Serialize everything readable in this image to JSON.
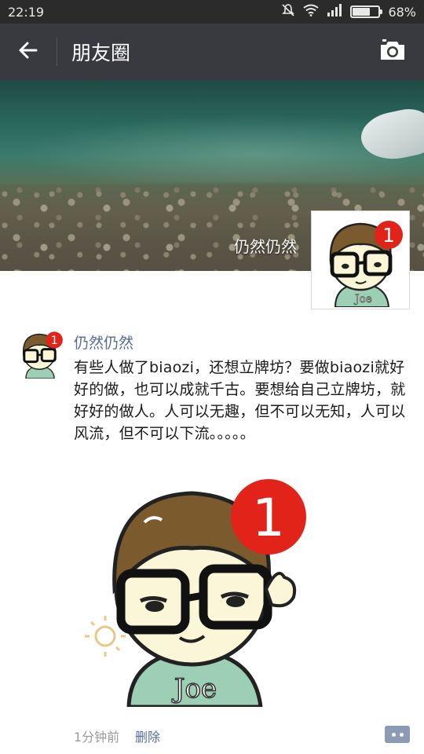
{
  "status_bar": {
    "time": "22:19",
    "battery_percent": "68%",
    "battery_level": 0.68
  },
  "nav": {
    "title": "朋友圈",
    "back_icon": "arrow-left-icon",
    "camera_icon": "camera-icon"
  },
  "cover": {
    "user_name": "仍然仍然",
    "avatar_badge": "1"
  },
  "post": {
    "author": "仍然仍然",
    "avatar_badge": "1",
    "text": "有些人做了biaozi，还想立牌坊？要做biaozi就好好的做，也可以成就千古。要想给自己立牌坊，就好好的做人。人可以无趣，但不可以无知，人可以风流，但不可以下流。。。。。",
    "image_badge": "1",
    "image_shirt_text": "Joe",
    "time": "1分钟前",
    "delete_label": "删除"
  },
  "colors": {
    "nav_bg": "#393a3f",
    "status_bg": "#2b2b2b",
    "link_blue": "#576b95",
    "badge_red": "#e2231a"
  }
}
